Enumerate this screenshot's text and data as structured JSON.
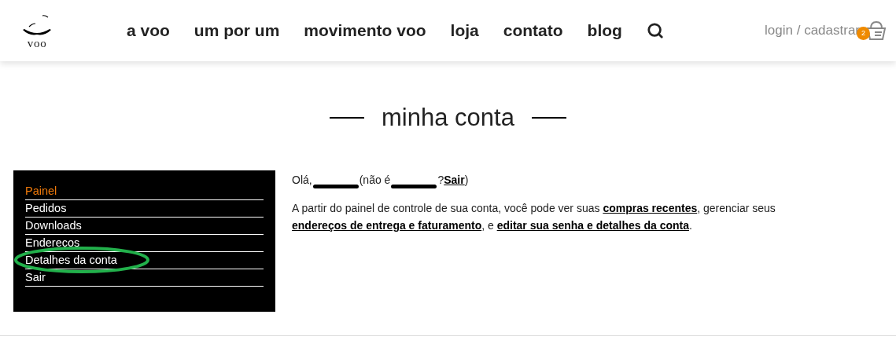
{
  "logo": {
    "text": "voo"
  },
  "nav": [
    {
      "label": "a voo"
    },
    {
      "label": "um por um"
    },
    {
      "label": "movimento voo"
    },
    {
      "label": "loja"
    },
    {
      "label": "contato"
    },
    {
      "label": "blog"
    }
  ],
  "account_link": "login / cadastrar",
  "cart": {
    "count": "2"
  },
  "page_title": "minha conta",
  "sidebar": {
    "items": [
      {
        "label": "Painel",
        "selected": true,
        "circled": false
      },
      {
        "label": "Pedidos",
        "selected": false,
        "circled": false
      },
      {
        "label": "Downloads",
        "selected": false,
        "circled": false
      },
      {
        "label": "Endereços",
        "selected": false,
        "circled": false
      },
      {
        "label": "Detalhes da conta",
        "selected": false,
        "circled": true
      },
      {
        "label": "Sair",
        "selected": false,
        "circled": false
      }
    ]
  },
  "greeting": [
    {
      "kind": "text",
      "text": "Olá,"
    },
    {
      "kind": "redacted"
    },
    {
      "kind": "text",
      "text": "(não é"
    },
    {
      "kind": "redacted"
    },
    {
      "kind": "text",
      "text": "?"
    },
    {
      "kind": "link",
      "text": "Sair"
    },
    {
      "kind": "text",
      "text": ")"
    }
  ],
  "intro": [
    {
      "kind": "text",
      "text": "A partir do painel de controle de sua conta, você pode ver suas "
    },
    {
      "kind": "link",
      "text": "compras recentes"
    },
    {
      "kind": "text",
      "text": ", gerenciar seus "
    },
    {
      "kind": "link",
      "text": "endereços de entrega e faturamento"
    },
    {
      "kind": "text",
      "text": ", e "
    },
    {
      "kind": "link",
      "text": "editar sua senha e detalhes da conta"
    },
    {
      "kind": "text",
      "text": "."
    }
  ]
}
